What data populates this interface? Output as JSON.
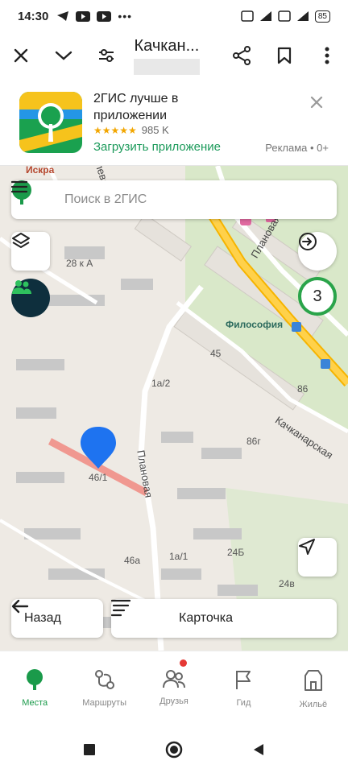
{
  "status_bar": {
    "time": "14:30",
    "battery": "85"
  },
  "browser": {
    "page_title": "Качкан..."
  },
  "ad": {
    "title": "2ГИС лучше в приложении",
    "rating_stars": "★★★★★",
    "reviews": "985 K",
    "cta": "Загрузить приложение",
    "label": "Реклама • 0+"
  },
  "map": {
    "search_placeholder": "Поиск в 2ГИС",
    "cluster_count": "3",
    "labels": {
      "iskra": "Искра",
      "leva": "левая",
      "b28a": "28 к А",
      "filosofia": "Философия",
      "b45": "45",
      "b86": "86",
      "b86g": "86г",
      "b1a2": "1а/2",
      "b46_1": "46/1",
      "b46a": "46а",
      "b1a1": "1а/1",
      "b24b": "24Б",
      "b24v": "24в",
      "planovaya_top": "Плановая",
      "planovaya": "Плановая",
      "kachkanarskaya": "Качканарская"
    },
    "back_label": "Назад",
    "card_label": "Карточка"
  },
  "bottom_nav": [
    {
      "label": "Места",
      "icon": "places-icon",
      "active": true
    },
    {
      "label": "Маршруты",
      "icon": "routes-icon",
      "active": false
    },
    {
      "label": "Друзья",
      "icon": "friends-icon",
      "active": false
    },
    {
      "label": "Гид",
      "icon": "guide-flag-icon",
      "active": false
    },
    {
      "label": "Жильё",
      "icon": "housing-icon",
      "active": false
    }
  ],
  "colors": {
    "brand_green": "#1a9a4a",
    "road_yellow": "#f6b400",
    "pin_blue": "#1e73f0",
    "friends_bg": "#0e2f3d"
  }
}
